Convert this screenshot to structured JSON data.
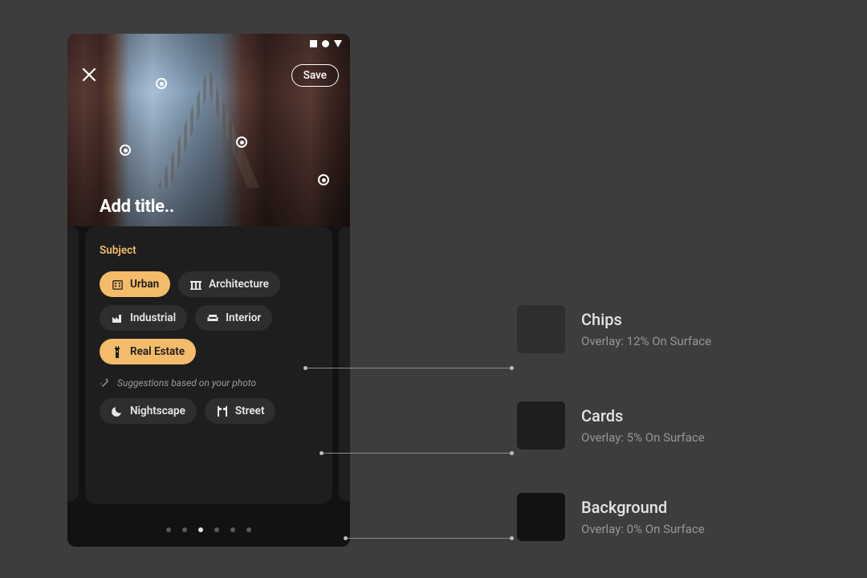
{
  "header": {
    "save_label": "Save",
    "title_placeholder": "Add title.."
  },
  "card": {
    "section_label": "Subject",
    "chips": [
      {
        "label": "Urban",
        "selected": true
      },
      {
        "label": "Architecture",
        "selected": false
      },
      {
        "label": "Industrial",
        "selected": false
      },
      {
        "label": "Interior",
        "selected": false
      },
      {
        "label": "Real Estate",
        "selected": true
      }
    ],
    "suggestion_hint": "Suggestions based on your photo",
    "suggestion_chips": [
      {
        "label": "Nightscape"
      },
      {
        "label": "Street"
      }
    ]
  },
  "pager": {
    "count": 6,
    "active_index": 2
  },
  "legend": [
    {
      "title": "Chips",
      "subtitle": "Overlay: 12% On Surface",
      "color": "#2e2e2e"
    },
    {
      "title": "Cards",
      "subtitle": "Overlay: 5% On Surface",
      "color": "#1e1e1e"
    },
    {
      "title": "Background",
      "subtitle": "Overlay: 0% On Surface",
      "color": "#121212"
    }
  ]
}
